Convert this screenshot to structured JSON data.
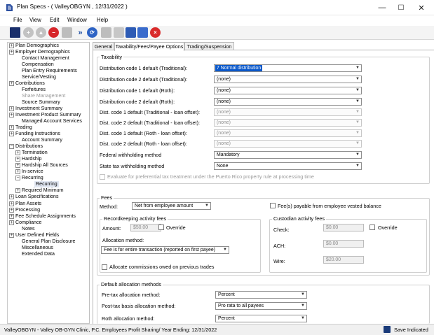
{
  "window": {
    "title": "Plan Specs - ( ValleyOBGYN , 12/31/2022 )",
    "minimize": "—",
    "maximize": "☐",
    "close": "✕"
  },
  "menu": [
    "File",
    "View",
    "Edit",
    "Window",
    "Help"
  ],
  "toolbar_icons": [
    "save-icon",
    "add-icon",
    "up-icon",
    "remove-icon",
    "delete-icon",
    "forward-icon",
    "refresh-icon",
    "print-preview-icon",
    "print-icon",
    "notes-icon",
    "book-icon",
    "close-red-icon"
  ],
  "tree": {
    "items": [
      {
        "label": "Plan Demographics",
        "exp": "+"
      },
      {
        "label": "Employer Demographics",
        "exp": "+"
      },
      {
        "label": "Contact Management"
      },
      {
        "label": "Compensation"
      },
      {
        "label": "Plan Entry Requirements"
      },
      {
        "label": "Service/Vesting"
      },
      {
        "label": "Contributions",
        "exp": "+"
      },
      {
        "label": "Forfeitures"
      },
      {
        "label": "Share Management"
      },
      {
        "label": "Source Summary"
      },
      {
        "label": "Investment Summary",
        "exp": "+"
      },
      {
        "label": "Investment Product Summary",
        "exp": "+"
      },
      {
        "label": "Managed Account Services"
      },
      {
        "label": "Trading",
        "exp": "+"
      },
      {
        "label": "Funding Instructions",
        "exp": "+"
      },
      {
        "label": "Account Summary"
      },
      {
        "label": "Distributions",
        "exp": "−"
      },
      {
        "label": "Termination",
        "exp": "+"
      },
      {
        "label": "Hardship",
        "exp": "+"
      },
      {
        "label": "Hardship All Sources",
        "exp": "+"
      },
      {
        "label": "In-service",
        "exp": "+"
      },
      {
        "label": "Recurring",
        "exp": "−"
      },
      {
        "label": "Recurring"
      },
      {
        "label": "Required Minimum",
        "exp": "+"
      },
      {
        "label": "Loan Specifications",
        "exp": "+"
      },
      {
        "label": "Plan Assets",
        "exp": "+"
      },
      {
        "label": "Processing",
        "exp": "+"
      },
      {
        "label": "Fee Schedule Assignments",
        "exp": "+"
      },
      {
        "label": "Compliance",
        "exp": "+"
      },
      {
        "label": "Notes"
      },
      {
        "label": "User Defined Fields",
        "exp": "+"
      },
      {
        "label": "General Plan Disclosure"
      },
      {
        "label": "Miscellaneous"
      },
      {
        "label": "Extended Data"
      }
    ]
  },
  "tabs": [
    "General",
    "Taxability/Fees/Payee Options",
    "Trading/Suspension"
  ],
  "taxability": {
    "legend": "Taxability",
    "rows": [
      {
        "label": "Distribution code 1 default (Traditional):",
        "value": "7 Normal distribution"
      },
      {
        "label": "Distribution code 2 default (Traditional):",
        "value": "(none)"
      },
      {
        "label": "Distribution code 1 default (Roth):",
        "value": "(none)"
      },
      {
        "label": "Distribution code 2 default (Roth):",
        "value": "(none)"
      },
      {
        "label": "Dist. code 1 default (Traditional - loan offset):",
        "value": "(none)"
      },
      {
        "label": "Dist. code 2 default (Traditional - loan offset):",
        "value": "(none)"
      },
      {
        "label": "Dist. code 1 default (Roth - loan offset):",
        "value": "(none)"
      },
      {
        "label": "Dist. code 2 default (Roth - loan offset):",
        "value": "(none)"
      },
      {
        "label": "Federal withholding method",
        "value": "Mandatory"
      },
      {
        "label": "State tax withholding method",
        "value": "None"
      }
    ],
    "puerto_rico_label": "Evaluate for preferential tax treatment under the Puerto Rico property rule at processing time"
  },
  "fees": {
    "legend": "Fees",
    "method_label": "Method:",
    "method_value": "Net from employee amount",
    "vested_label": "Fee(s) payable from employee vested balance",
    "recordkeeping": {
      "legend": "Recordkeeping activity fees",
      "amount_label": "Amount:",
      "amount_value": "$50.00",
      "override_label": "Override",
      "allocation_label": "Allocation method:",
      "allocation_value": "Fee is for entire transaction (reported on first payee)",
      "commissions_label": "Allocate commissions owed on previous trades"
    },
    "custodian": {
      "legend": "Custodian activity fees",
      "check_label": "Check:",
      "check_value": "$0.00",
      "override_label": "Override",
      "ach_label": "ACH:",
      "ach_value": "$0.00",
      "wire_label": "Wire:",
      "wire_value": "$20.00"
    }
  },
  "default_allocation": {
    "legend": "Default allocation methods",
    "rows": [
      {
        "label": "Pre-tax allocation method:",
        "value": "Percent"
      },
      {
        "label": "Post-tax basis allocation method:",
        "value": "Pro rata to all payees"
      },
      {
        "label": "Roth allocation method:",
        "value": "Percent"
      }
    ]
  },
  "status": {
    "text": "ValleyOBGYN - Valley OB-GYN Clinic, P.C. Employees Profit Sharing/  Year Ending: 12/31/2022",
    "save_indicated": "Save Indicated"
  },
  "colors": {
    "accent": "#0a58ca",
    "title_icon": "#1f4fa3"
  }
}
